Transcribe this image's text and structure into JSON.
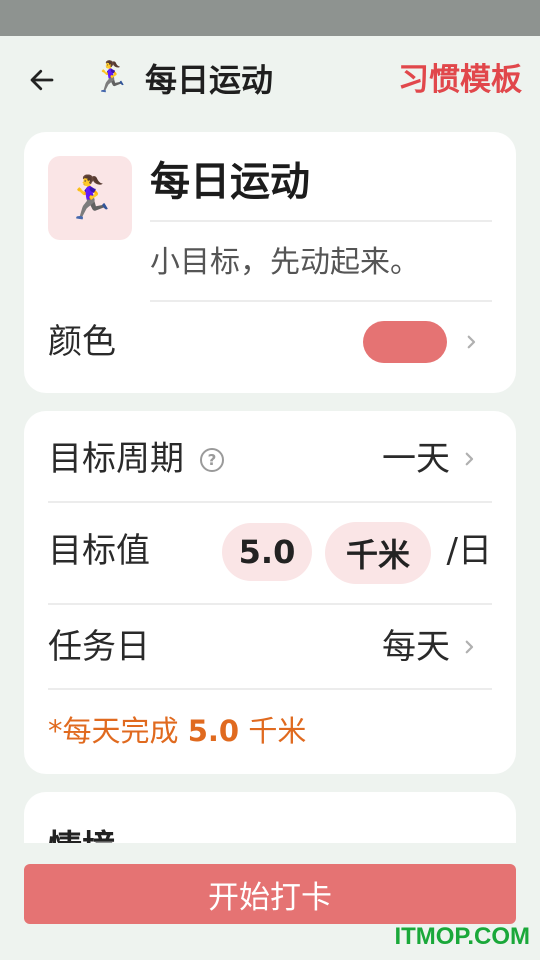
{
  "header": {
    "title_emoji": "🏃‍♀️",
    "title": "每日运动",
    "template_link": "习惯模板"
  },
  "habit": {
    "icon": "🏃‍♀️",
    "name": "每日运动",
    "description": "小目标，先动起来。",
    "color_label": "颜色",
    "color_value": "#e57373"
  },
  "goal": {
    "period_label": "目标周期",
    "period_value": "一天",
    "value_label": "目标值",
    "value_amount": "5.0",
    "value_unit": "千米",
    "value_suffix": "/日",
    "task_day_label": "任务日",
    "task_day_value": "每天",
    "summary_prefix": "*每天完成",
    "summary_amount": "5.0",
    "summary_unit": "千米"
  },
  "scenario": {
    "title": "情境"
  },
  "actions": {
    "start_button": "开始打卡"
  },
  "watermark": "ITMOP.COM",
  "colors": {
    "accent": "#e1474b",
    "button": "#e57373",
    "pill_bg": "#fae5e6",
    "summary_text": "#e06a1f"
  }
}
